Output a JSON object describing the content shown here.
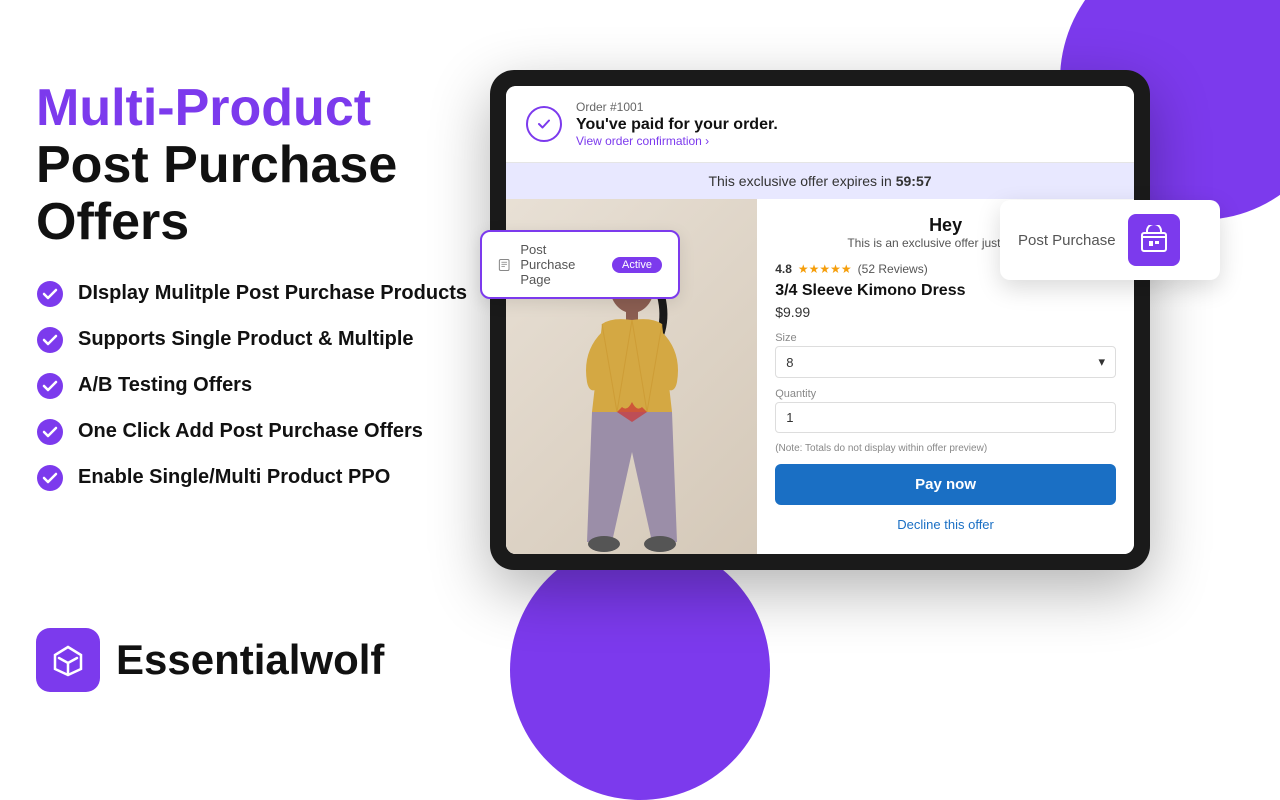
{
  "background": {
    "circle_color": "#7c3aed"
  },
  "headline": {
    "line1_highlight": "Multi-Product",
    "line2": "Post Purchase",
    "line3": "Offers"
  },
  "features": [
    {
      "id": "f1",
      "text": "DIsplay Mulitple Post Purchase Products"
    },
    {
      "id": "f2",
      "text": "Supports Single Product & Multiple"
    },
    {
      "id": "f3",
      "text": "A/B Testing Offers"
    },
    {
      "id": "f4",
      "text": "One Click Add Post Purchase Offers"
    },
    {
      "id": "f5",
      "text": "Enable Single/Multi Product PPO"
    }
  ],
  "order": {
    "number": "Order #1001",
    "title": "You've paid for your order.",
    "link": "View order confirmation ›"
  },
  "timer": {
    "label": "This exclusive offer expires in",
    "time": "59:57"
  },
  "offer_header": {
    "hey": "Hey",
    "subtitle": "This is an exclusive offer just for you:"
  },
  "product": {
    "rating_score": "4.8",
    "stars": "★★★★★",
    "reviews": "(52 Reviews)",
    "name": "3/4 Sleeve Kimono Dress",
    "price": "$9.99",
    "size_label": "Size",
    "size_value": "8",
    "quantity_label": "Quantity",
    "quantity_value": "1",
    "note": "(Note: Totals do not display within offer preview)",
    "pay_button": "Pay now",
    "decline_link": "Decline this offer"
  },
  "floating_card_left": {
    "icon": "📋",
    "label": "Post Purchase Page",
    "badge": "Active"
  },
  "floating_card_right": {
    "label": "Post Purchase"
  },
  "brand": {
    "name": "Essentialwolf"
  }
}
